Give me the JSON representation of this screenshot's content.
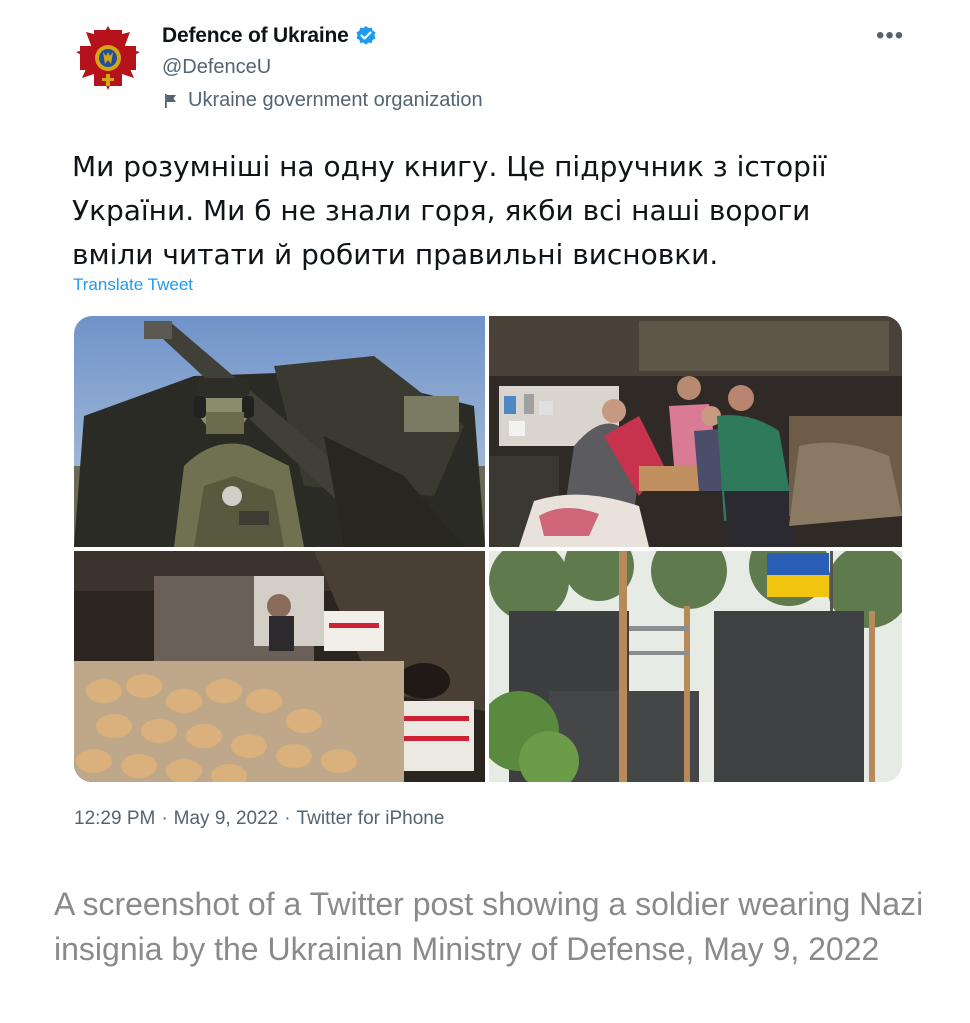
{
  "tweet": {
    "author_name": "Defence of Ukraine",
    "handle": "@DefenceU",
    "org_label": "Ukraine government organization",
    "text": "Ми розумніші на одну книгу. Це підручник з історії України. Ми б не знали горя, якби всі наші вороги вміли читати й робити правильні висновки.",
    "translate_label": "Translate Tweet",
    "time": "12:29 PM",
    "date": "May 9, 2022",
    "source": "Twitter for iPhone",
    "more_label": "•••",
    "sep": "·"
  },
  "icons": {
    "avatar": "ministry-emblem-icon",
    "verified": "verified-badge-icon",
    "org": "flag-icon",
    "more": "more-icon"
  },
  "colors": {
    "accent": "#1d9bf0",
    "muted": "#536471",
    "emblem_red": "#b5121b",
    "emblem_gold": "#d4a514"
  },
  "caption": "A screenshot of a Twitter post showing a soldier wearing Nazi insignia by the Ukrainian Ministry of Defense, May 9, 2022"
}
